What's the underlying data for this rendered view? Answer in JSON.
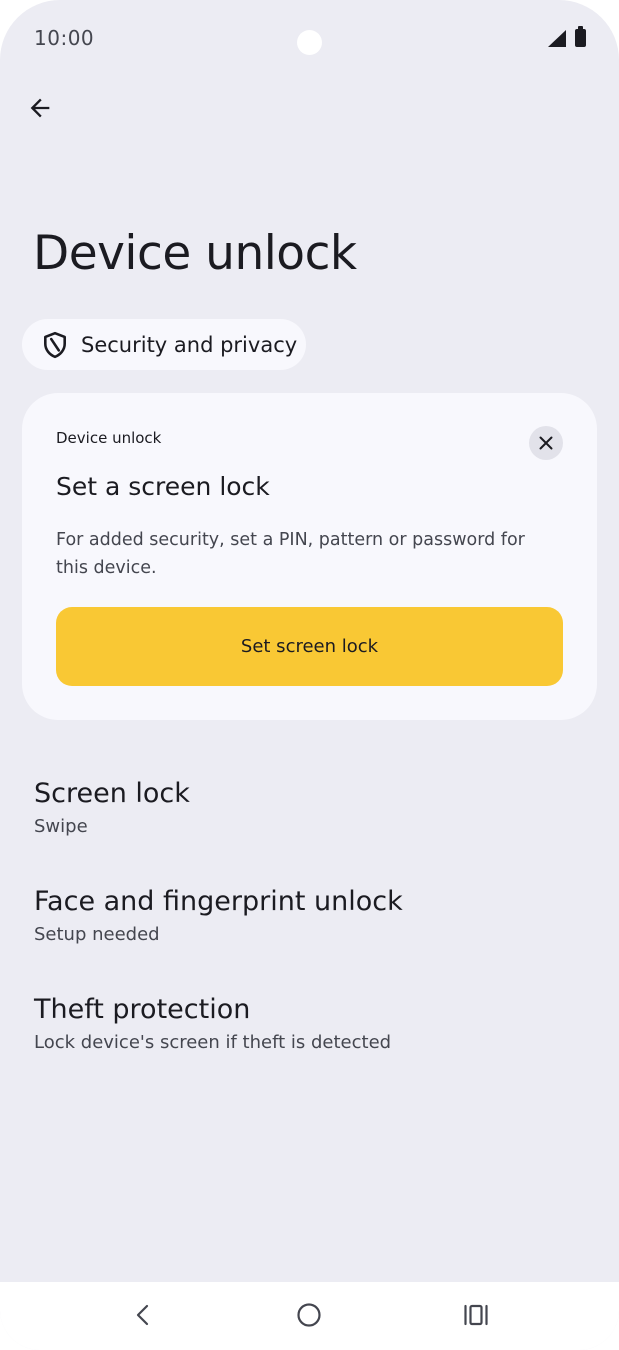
{
  "status_bar": {
    "time": "10:00",
    "signal_icon": "cell-signal-icon",
    "battery_icon": "battery-icon"
  },
  "toolbar": {
    "back_icon": "arrow-back-icon"
  },
  "page": {
    "title": "Device unlock"
  },
  "breadcrumb": {
    "icon": "shield-icon",
    "label": "Security and privacy"
  },
  "card": {
    "eyebrow": "Device unlock",
    "title": "Set a screen lock",
    "body": "For added security, set a PIN, pattern or password for this device.",
    "button_label": "Set screen lock",
    "close_icon": "close-icon",
    "accent_color": "#f9c834"
  },
  "settings": {
    "items": [
      {
        "title": "Screen lock",
        "subtitle": "Swipe"
      },
      {
        "title": "Face and fingerprint unlock",
        "subtitle": "Setup needed"
      },
      {
        "title": "Theft protection",
        "subtitle": "Lock device's screen if theft is detected"
      }
    ]
  },
  "nav": {
    "back_icon": "nav-back-icon",
    "home_icon": "nav-home-icon",
    "recents_icon": "nav-recents-icon"
  }
}
